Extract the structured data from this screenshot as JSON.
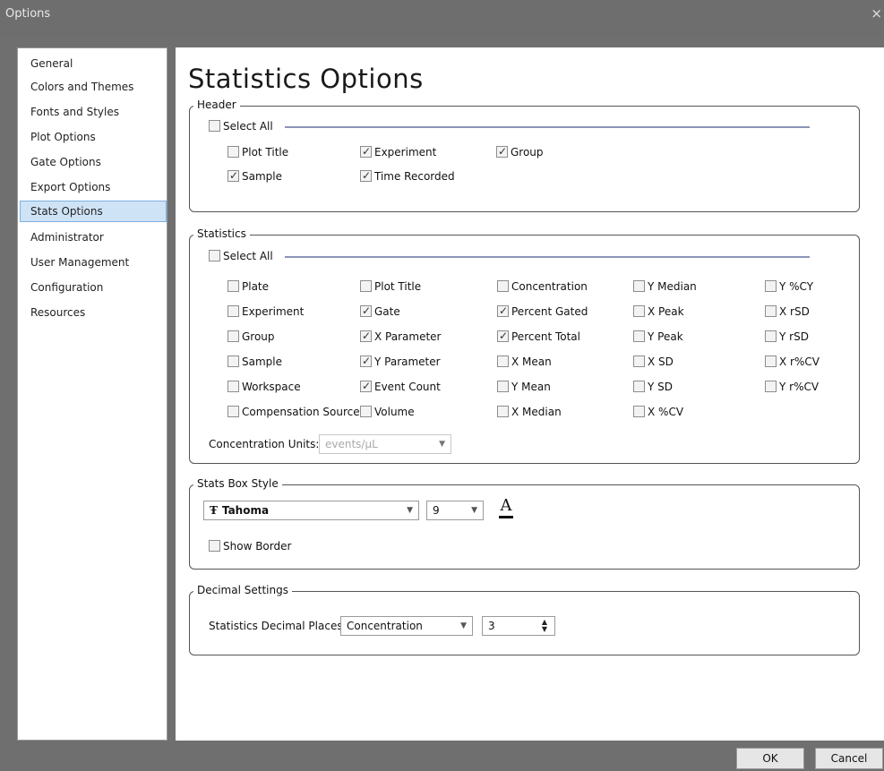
{
  "window": {
    "title": "Options",
    "close_glyph": "×"
  },
  "sidebar": {
    "items": [
      {
        "label": "General"
      },
      {
        "label": "Colors and Themes"
      },
      {
        "label": "Fonts and Styles"
      },
      {
        "label": "Plot Options"
      },
      {
        "label": "Gate Options"
      },
      {
        "label": "Export Options"
      },
      {
        "label": "Stats Options",
        "selected": true
      },
      {
        "label": "Administrator"
      },
      {
        "label": "User Management"
      },
      {
        "label": "Configuration"
      },
      {
        "label": "Resources"
      }
    ]
  },
  "page": {
    "title": "Statistics Options"
  },
  "header_group": {
    "legend": "Header",
    "select_all": {
      "label": "Select All",
      "checked": false
    },
    "items": [
      {
        "label": "Plot Title",
        "checked": false
      },
      {
        "label": "Experiment",
        "checked": true
      },
      {
        "label": "Group",
        "checked": true
      },
      {
        "label": "Sample",
        "checked": true
      },
      {
        "label": "Time Recorded",
        "checked": true
      }
    ]
  },
  "statistics_group": {
    "legend": "Statistics",
    "select_all": {
      "label": "Select All",
      "checked": false
    },
    "columns": [
      [
        {
          "label": "Plate",
          "checked": false
        },
        {
          "label": "Experiment",
          "checked": false
        },
        {
          "label": "Group",
          "checked": false
        },
        {
          "label": "Sample",
          "checked": false
        },
        {
          "label": "Workspace",
          "checked": false
        },
        {
          "label": "Compensation Source",
          "checked": false
        }
      ],
      [
        {
          "label": "Plot Title",
          "checked": false
        },
        {
          "label": "Gate",
          "checked": true
        },
        {
          "label": "X Parameter",
          "checked": true
        },
        {
          "label": "Y Parameter",
          "checked": true
        },
        {
          "label": "Event Count",
          "checked": true
        },
        {
          "label": "Volume",
          "checked": false
        }
      ],
      [
        {
          "label": "Concentration",
          "checked": false
        },
        {
          "label": "Percent Gated",
          "checked": true
        },
        {
          "label": "Percent Total",
          "checked": true
        },
        {
          "label": "X Mean",
          "checked": false
        },
        {
          "label": "Y Mean",
          "checked": false
        },
        {
          "label": "X Median",
          "checked": false
        }
      ],
      [
        {
          "label": "Y Median",
          "checked": false
        },
        {
          "label": "X Peak",
          "checked": false
        },
        {
          "label": "Y Peak",
          "checked": false
        },
        {
          "label": "X SD",
          "checked": false
        },
        {
          "label": "Y SD",
          "checked": false
        },
        {
          "label": "X %CV",
          "checked": false
        }
      ],
      [
        {
          "label": "Y %CY",
          "checked": false
        },
        {
          "label": "X rSD",
          "checked": false
        },
        {
          "label": "Y rSD",
          "checked": false
        },
        {
          "label": "X r%CV",
          "checked": false
        },
        {
          "label": "Y r%CV",
          "checked": false
        }
      ]
    ],
    "concentration_units": {
      "label": "Concentration Units:",
      "value": "events/μL",
      "disabled": true
    }
  },
  "stats_box_group": {
    "legend": "Stats Box Style",
    "font_name": "Tahoma",
    "font_glyph": "Ŧ",
    "font_size": "9",
    "font_color_glyph": "A",
    "show_border": {
      "label": "Show Border",
      "checked": false
    }
  },
  "decimal_group": {
    "legend": "Decimal Settings",
    "label": "Statistics Decimal Places:",
    "type_value": "Concentration",
    "places_value": "3"
  },
  "footer": {
    "ok_label": "OK",
    "cancel_label": "Cancel"
  },
  "glyphs": {
    "check": "✓",
    "dropdown": "▼",
    "spin_up": "▲",
    "spin_down": "▼"
  },
  "icons": {
    "close": "close-icon",
    "font": "font-icon",
    "font_color": "font-color-icon",
    "dropdown": "chevron-down-icon",
    "spin": "spin-arrows-icon"
  }
}
